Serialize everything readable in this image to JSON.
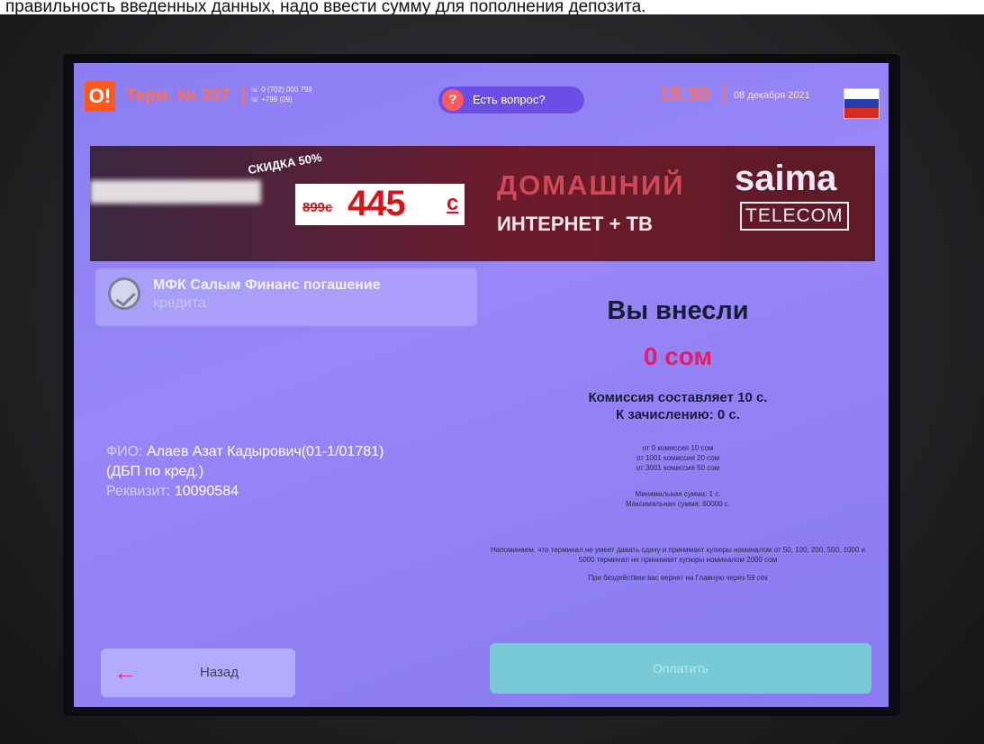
{
  "caption": "правильность введенных данных, надо ввести сумму для пополнения депозита.",
  "header": {
    "logo_text": "O!",
    "terminal": "Терм. № 307",
    "separator": "|",
    "phones": [
      "0 (702) 000 799",
      "+799 (09)"
    ],
    "question_label": "Есть вопрос?",
    "question_icon": "question-circle-icon",
    "time": "15:30",
    "date": "08 декабря 2021",
    "flag": "russia-flag",
    "flag_colors": [
      "#ffffff",
      "#1f3fae",
      "#d52b1e"
    ]
  },
  "banner": {
    "discount": "СКИДКА 50%",
    "old_price": "899с",
    "new_price": "445",
    "currency": "с",
    "headline_1": "ДОМАШНИЙ",
    "headline_2": "ИНТЕРНЕТ + ТВ",
    "brand": "saima",
    "brand_sub": "TELECOM"
  },
  "service": {
    "icon": "image-placeholder-icon",
    "title": "МФК Салым Финанс погашение",
    "subtitle": "кредита"
  },
  "details": {
    "fio_label": "ФИО:",
    "fio_value": "Алаев Азат Кадырович(01-1/01781)",
    "fio_note": "(ДБП по кред.)",
    "req_label": "Реквизит:",
    "req_value": "10090584"
  },
  "payment": {
    "title": "Вы внесли",
    "amount": "0 сом",
    "commission": "Комиссия составляет 10 с.",
    "to_credit": "К зачислению: 0 с.",
    "tiers": [
      "от 0 комиссия 10 сом",
      "от 1001 комиссия 20 сом",
      "от 3001 комиссия 50 сом"
    ],
    "min": "Минимальная сумма: 1 с.",
    "max": "Максимальная сумма: 60000 с.",
    "reminder": "Напоминаем, что терминал не умеет давать сдачу и принимает купюры номиналом от 50, 100, 200, 500, 1000 и 5000 терминал не принимает купюры номиналом 2000 сом",
    "timeout": "При бездействии вас вернет на Главную через 59 сек"
  },
  "buttons": {
    "back_icon": "arrow-left-icon",
    "back": "Назад",
    "pay": "Оплатить"
  },
  "colors": {
    "screen": "#8f80f5",
    "accent": "#ff6f55",
    "amount": "#e21e6a",
    "pay_button": "#7ac9d6"
  }
}
